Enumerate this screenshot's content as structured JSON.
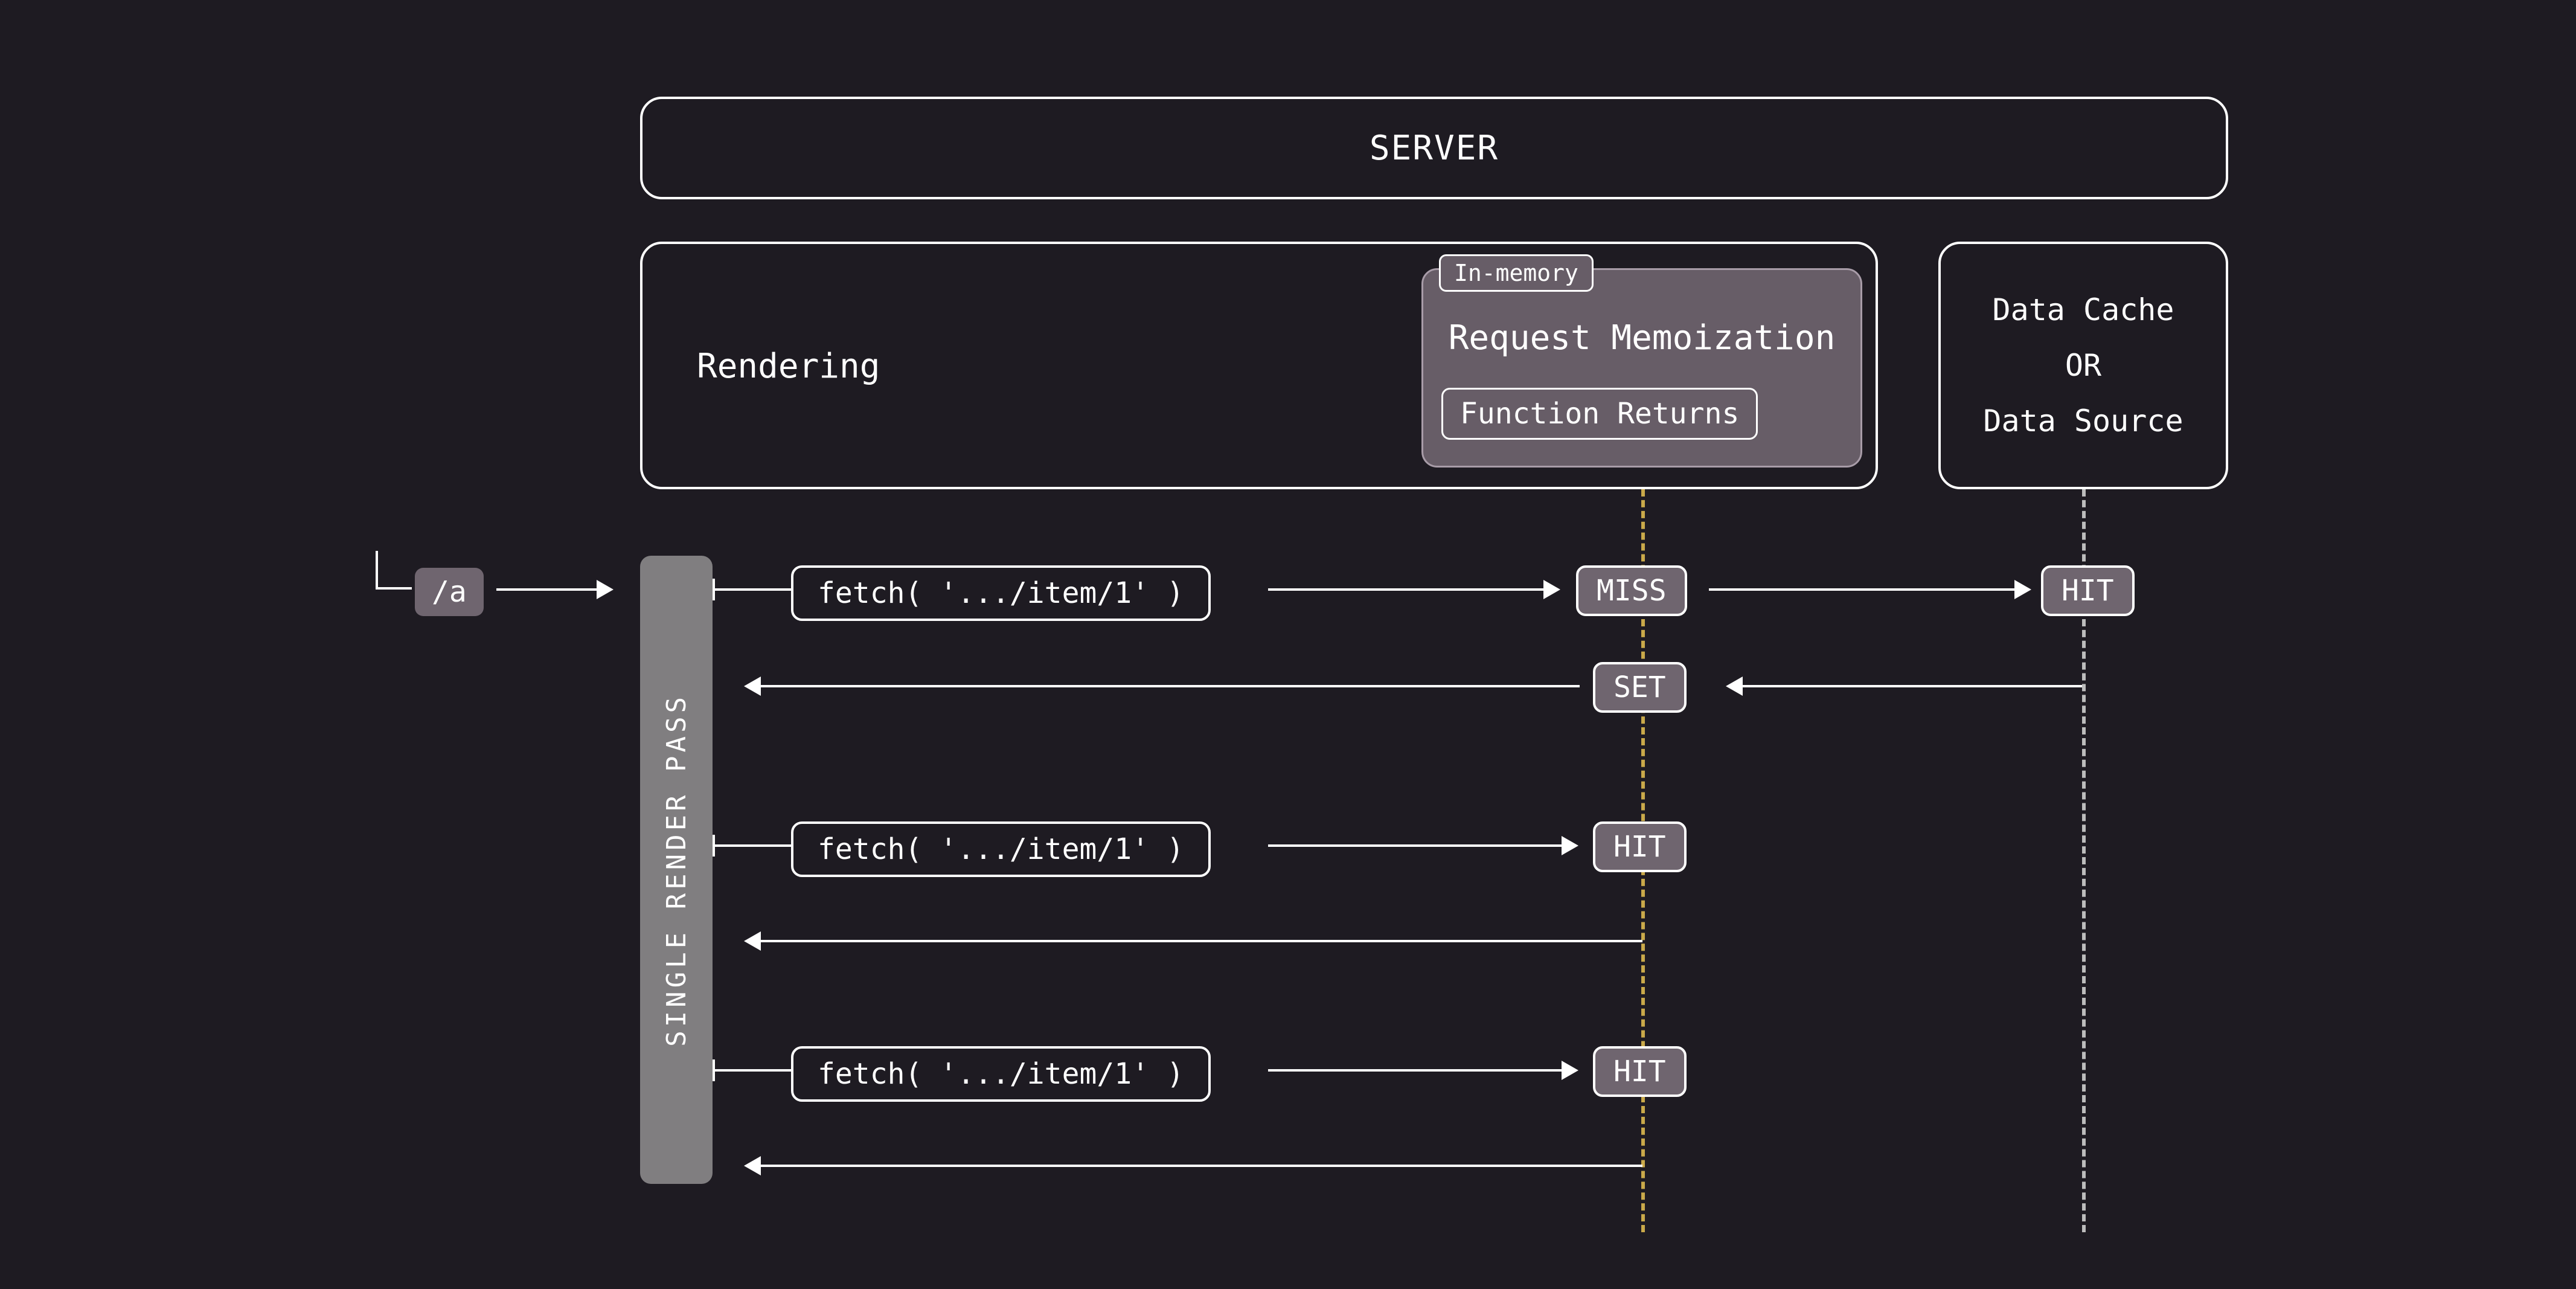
{
  "header": {
    "server": "SERVER"
  },
  "rendering": {
    "label": "Rendering",
    "memo": {
      "badge": "In-memory",
      "title": "Request Memoization",
      "fn": "Function Returns"
    }
  },
  "datacache": {
    "l1": "Data Cache",
    "l2": "OR",
    "l3": "Data Source"
  },
  "bar": "SINGLE RENDER PASS",
  "route": "/a",
  "fetchLabel": "fetch( '.../item/1' )",
  "badges": {
    "miss": "MISS",
    "hit": "HIT",
    "set": "SET"
  }
}
